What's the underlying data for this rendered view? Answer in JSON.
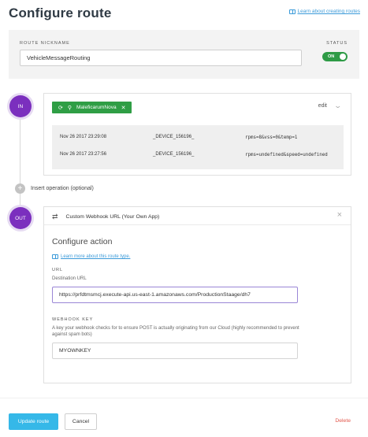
{
  "page": {
    "title": "Configure route",
    "learn_link": "Learn about creating routes"
  },
  "route": {
    "nickname_label": "ROUTE NICKNAME",
    "nickname_value": "VehicleMessageRouting",
    "status_label": "STATUS",
    "status_toggle": "ON"
  },
  "input_stage": {
    "badge": "IN",
    "device_name": "MaleficarumNova",
    "edit_label": "edit",
    "events": [
      {
        "time": "Nov 26 2017 23:29:08",
        "device": "_DEVICE_156196_",
        "data": "rpms=8&vss=0&temp=1"
      },
      {
        "time": "Nov 26 2017 23:27:56",
        "device": "_DEVICE_156196_",
        "data": "rpms=undefined&speed=undefined"
      }
    ]
  },
  "insert_operation": {
    "label": "Insert operation (optional)"
  },
  "output_stage": {
    "badge": "OUT",
    "title": "Custom Webhook URL (Your Own App)",
    "configure_title": "Configure action",
    "learn_link": "Learn more about this route type.",
    "url": {
      "label": "URL",
      "help": "Destination URL",
      "value": "https://prfdtmsmcj.execute-api.us-east-1.amazonaws.com/ProductionStaage/dh7"
    },
    "webhook_key": {
      "label": "WEBHOOK KEY",
      "help": "A key your webhook checks for to ensure POST is actually originating from our Cloud (highly recommended to prevent against spam bots)",
      "value": "MYOWNKEY"
    }
  },
  "footer": {
    "update_label": "Update route",
    "cancel_label": "Cancel",
    "delete_label": "Delete"
  },
  "colors": {
    "accent": "#7b2fbe",
    "primary_button": "#35b8e8",
    "toggle_on": "#2e9b46",
    "device_tag": "#2f9e45",
    "delete": "#e2574c",
    "link": "#3b9ad9"
  },
  "icons": {
    "learn": "book-icon",
    "device_status": "refresh-icon",
    "device_type": "device-icon",
    "remove_device": "close-icon",
    "collapse": "chevron-down-icon",
    "insert": "plus-icon",
    "output_type": "swap-arrows-icon",
    "close_output": "close-icon"
  }
}
